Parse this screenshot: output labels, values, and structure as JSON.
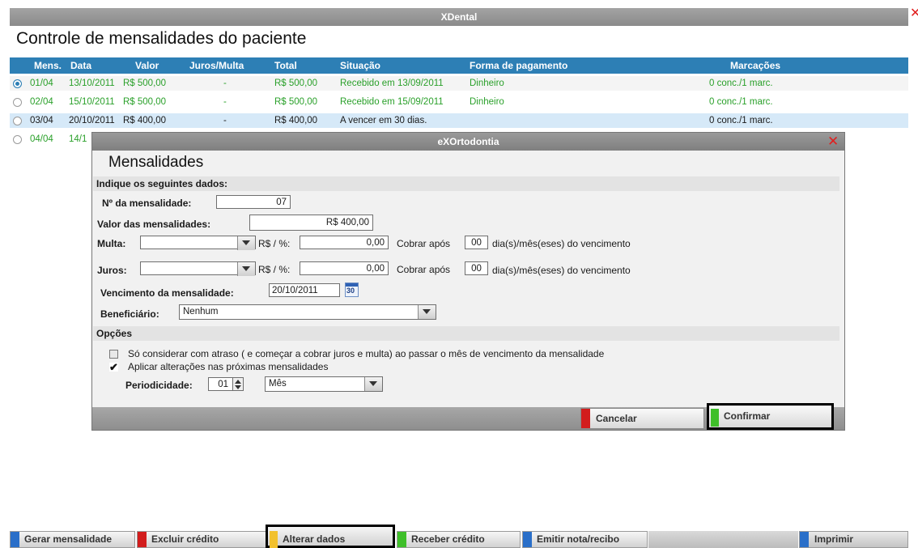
{
  "main": {
    "window_title": "XDental",
    "heading": "Controle de mensalidades do paciente",
    "columns": [
      "Mens.",
      "Data",
      "Valor",
      "Juros/Multa",
      "Total",
      "Situação",
      "Forma de pagamento",
      "Marcações"
    ],
    "rows": [
      {
        "mens": "01/04",
        "data": "13/10/2011",
        "valor": "R$ 500,00",
        "juros": "-",
        "total": "R$ 500,00",
        "situacao": "Recebido em 13/09/2011",
        "forma": "Dinheiro",
        "marcacoes": "0 conc./1 marc.",
        "selected": true
      },
      {
        "mens": "02/04",
        "data": "15/10/2011",
        "valor": "R$ 500,00",
        "juros": "-",
        "total": "R$ 500,00",
        "situacao": "Recebido em 15/09/2011",
        "forma": "Dinheiro",
        "marcacoes": "0 conc./1 marc.",
        "selected": false
      },
      {
        "mens": "03/04",
        "data": "20/10/2011",
        "valor": "R$ 400,00",
        "juros": "-",
        "total": "R$ 400,00",
        "situacao": "A vencer em 30 dias.",
        "forma": "",
        "marcacoes": "0 conc./1 marc.",
        "selected": false
      },
      {
        "mens": "04/04",
        "data": "14/1",
        "valor": "",
        "juros": "",
        "total": "",
        "situacao": "",
        "forma": "",
        "marcacoes": "",
        "selected": false
      }
    ]
  },
  "dialog": {
    "window_title": "eXOrtodontia",
    "heading": "Mensalidades",
    "section_dados": "Indique os seguintes dados:",
    "num_label": "Nº da mensalidade:",
    "num_value": "07",
    "valor_label": "Valor das mensalidades:",
    "valor_value": "R$ 400,00",
    "multa_label": "Multa:",
    "multa_select": "",
    "rs_label": "R$ / %:",
    "multa_value": "0,00",
    "cobrar_label": "Cobrar após",
    "multa_days": "00",
    "dias_label": "dia(s)/mês(eses) do vencimento",
    "juros_label": "Juros:",
    "juros_select": "",
    "juros_value": "0,00",
    "juros_days": "00",
    "venc_label": "Vencimento da mensalidade:",
    "venc_value": "20/10/2011",
    "calendar_day": "30",
    "benef_label": "Beneficiário:",
    "benef_value": "Nenhum",
    "section_opcoes": "Opções",
    "opt1_label": "Só considerar com atraso ( e começar a cobrar juros e multa) ao passar o mês de vencimento da mensalidade",
    "opt1_checked": false,
    "opt2_label": "Aplicar alterações nas próximas mensalidades",
    "opt2_checked": true,
    "period_label": "Periodicidade:",
    "period_value": "01",
    "period_unit": "Mês",
    "cancel_label": "Cancelar",
    "confirm_label": "Confirmar"
  },
  "toolbar": {
    "gerar": "Gerar mensalidade",
    "excluir": "Excluir crédito",
    "alterar": "Alterar dados",
    "receber": "Receber crédito",
    "emitir": "Emitir nota/recibo",
    "imprimir": "Imprimir"
  },
  "colors": {
    "header_blue": "#2d7fb5",
    "paid_green": "#2aa02a",
    "red_stripe": "#d21d1d",
    "green_stripe": "#3fbf2a",
    "blue_stripe": "#2a6fc9",
    "yellow_stripe": "#f2c12e",
    "selected_row": "#d6e9f8"
  }
}
